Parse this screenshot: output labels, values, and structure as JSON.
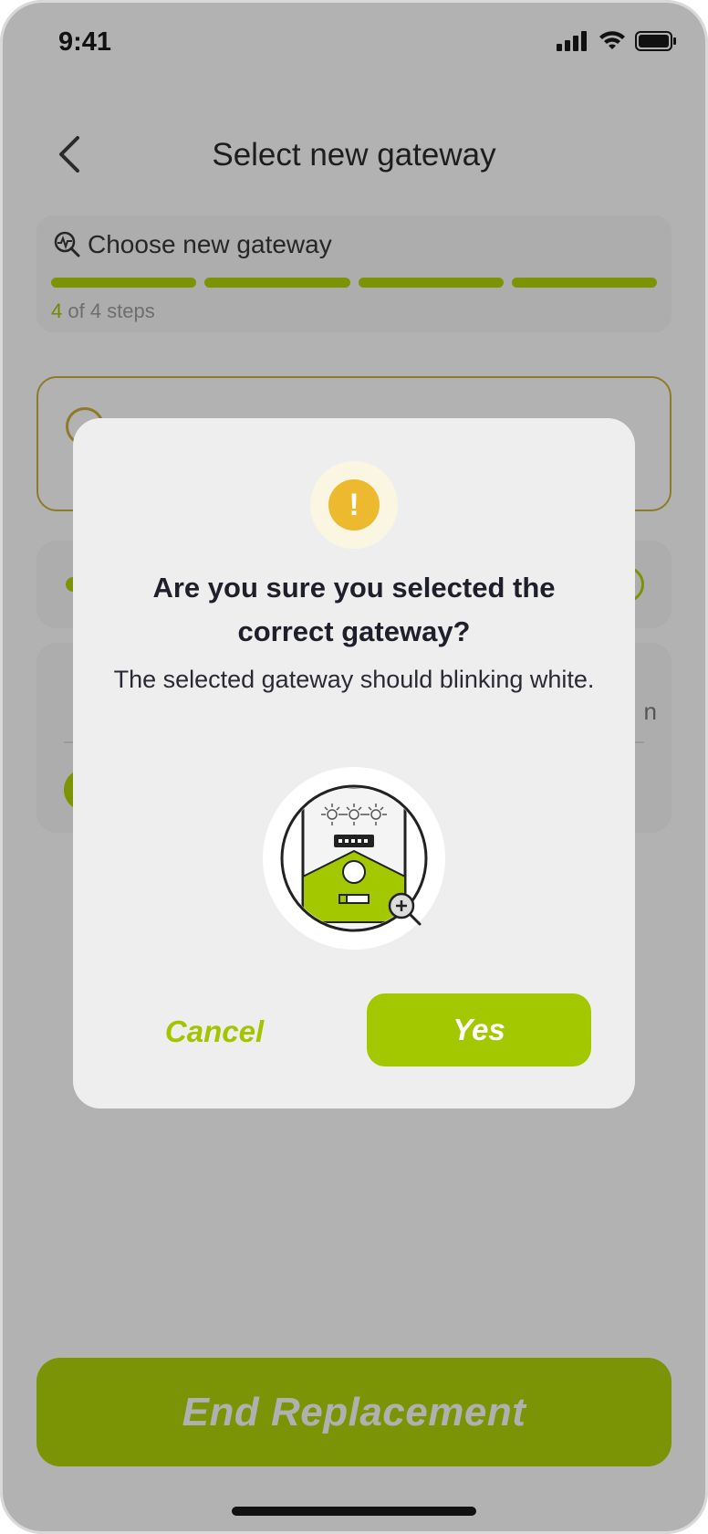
{
  "status": {
    "time": "9:41"
  },
  "header": {
    "title": "Select new gateway"
  },
  "progress": {
    "label": "Choose new gateway",
    "current_step": "4",
    "steps_suffix": " of 4 steps",
    "fraction_complete": 1.0
  },
  "background": {
    "partial_text": "n"
  },
  "modal": {
    "title": "Are you sure you selected the correct gateway?",
    "body": "The selected gateway should blinking white.",
    "warn_glyph": "!",
    "cancel_label": "Cancel",
    "yes_label": "Yes"
  },
  "footer": {
    "end_label": "End Replacement"
  },
  "colors": {
    "accent": "#a4c800",
    "accent_dimmed": "#7a9405",
    "warning": "#ecb92f",
    "overlay": "#b2b2b2"
  }
}
